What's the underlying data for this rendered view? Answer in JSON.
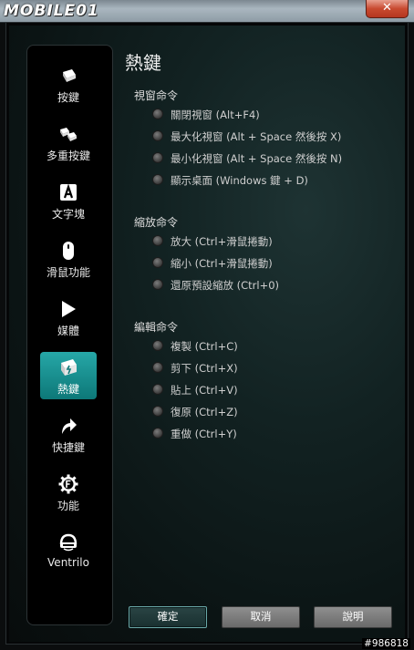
{
  "window": {
    "logo": "MOBILE01",
    "close_glyph": "✕"
  },
  "sidebar": {
    "items": [
      {
        "label": "按鍵",
        "icon": "key-icon"
      },
      {
        "label": "多重按鍵",
        "icon": "multi-key-icon"
      },
      {
        "label": "文字塊",
        "icon": "text-block-icon"
      },
      {
        "label": "滑鼠功能",
        "icon": "mouse-icon"
      },
      {
        "label": "媒體",
        "icon": "play-icon"
      },
      {
        "label": "熱鍵",
        "icon": "hotkey-icon",
        "active": true
      },
      {
        "label": "快捷鍵",
        "icon": "shortcut-arrow-icon"
      },
      {
        "label": "功能",
        "icon": "function-gear-icon"
      },
      {
        "label": "Ventrilo",
        "icon": "headset-icon"
      }
    ]
  },
  "main": {
    "title": "熱鍵",
    "groups": [
      {
        "title": "視窗命令",
        "options": [
          "關閉視窗 (Alt+F4)",
          "最大化視窗 (Alt + Space 然後按 X)",
          "最小化視窗 (Alt + Space 然後按 N)",
          "顯示桌面 (Windows 鍵 + D)"
        ]
      },
      {
        "title": "縮放命令",
        "options": [
          "放大 (Ctrl+滑鼠捲動)",
          "縮小 (Ctrl+滑鼠捲動)",
          "還原預設縮放 (Ctrl+0)"
        ]
      },
      {
        "title": "編輯命令",
        "options": [
          "複製 (Ctrl+C)",
          "剪下 (Ctrl+X)",
          "貼上 (Ctrl+V)",
          "復原 (Ctrl+Z)",
          "重做 (Ctrl+Y)"
        ]
      }
    ]
  },
  "buttons": {
    "ok": "確定",
    "cancel": "取消",
    "help": "說明"
  },
  "watermark": "#986818",
  "colors": {
    "accent": "#1a9a9a",
    "background": "#0b1414"
  }
}
